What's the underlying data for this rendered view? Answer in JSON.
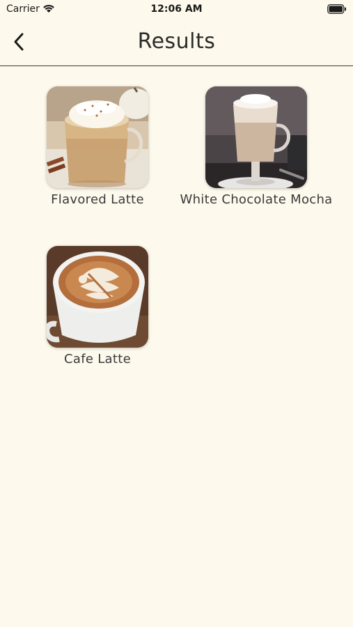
{
  "status_bar": {
    "carrier": "Carrier",
    "time": "12:06 AM"
  },
  "nav": {
    "title": "Results",
    "back_icon": "chevron-left-icon"
  },
  "results": [
    {
      "label": "Flavored Latte",
      "image": "flavored-latte-photo"
    },
    {
      "label": "White Chocolate Mocha",
      "image": "white-chocolate-mocha-photo"
    },
    {
      "label": "Cafe Latte",
      "image": "cafe-latte-photo"
    }
  ],
  "colors": {
    "background": "#fdf9ec",
    "text": "#2b2b2b",
    "divider": "#3a3a3a"
  }
}
